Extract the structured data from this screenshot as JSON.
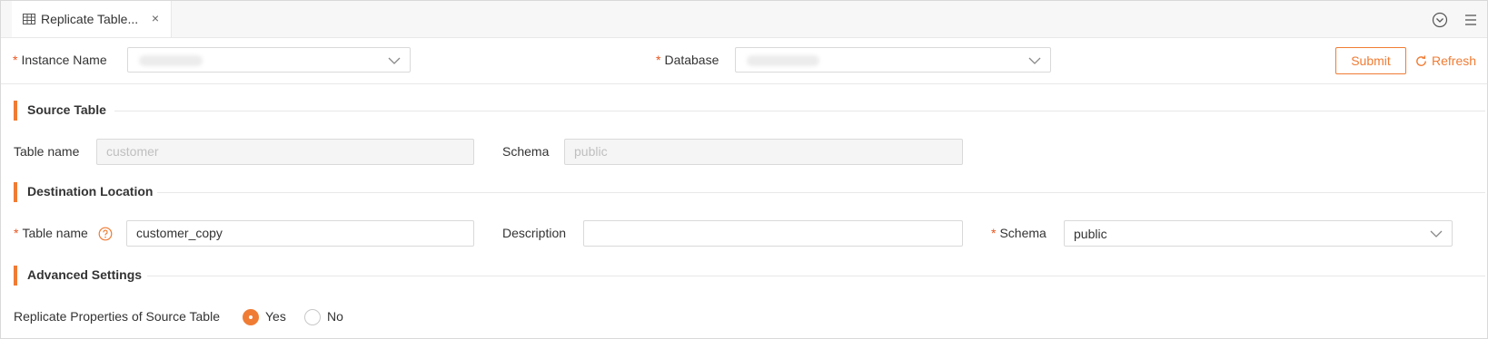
{
  "tab": {
    "title": "Replicate Table...",
    "icon": "table-icon",
    "close_label": "×"
  },
  "toolbar_icons": {
    "collapse": "chevron-circle-down-icon",
    "menu": "menu-lines-icon"
  },
  "header_form": {
    "instance_label": "Instance Name",
    "database_label": "Database",
    "required_mark": "*",
    "submit_label": "Submit",
    "refresh_label": "Refresh"
  },
  "source": {
    "title": "Source Table",
    "table_name_label": "Table name",
    "table_name_value": "customer",
    "schema_label": "Schema",
    "schema_value": "public"
  },
  "destination": {
    "title": "Destination Location",
    "table_name_label": "Table name",
    "table_name_value": "customer_copy",
    "description_label": "Description",
    "description_value": "",
    "schema_label": "Schema",
    "schema_value": "public"
  },
  "advanced": {
    "title": "Advanced Settings",
    "replicate_label": "Replicate Properties of Source Table",
    "options": [
      {
        "label": "Yes",
        "selected": true
      },
      {
        "label": "No",
        "selected": false
      }
    ]
  },
  "colors": {
    "accent": "#f07c34",
    "required": "#e8551f"
  }
}
